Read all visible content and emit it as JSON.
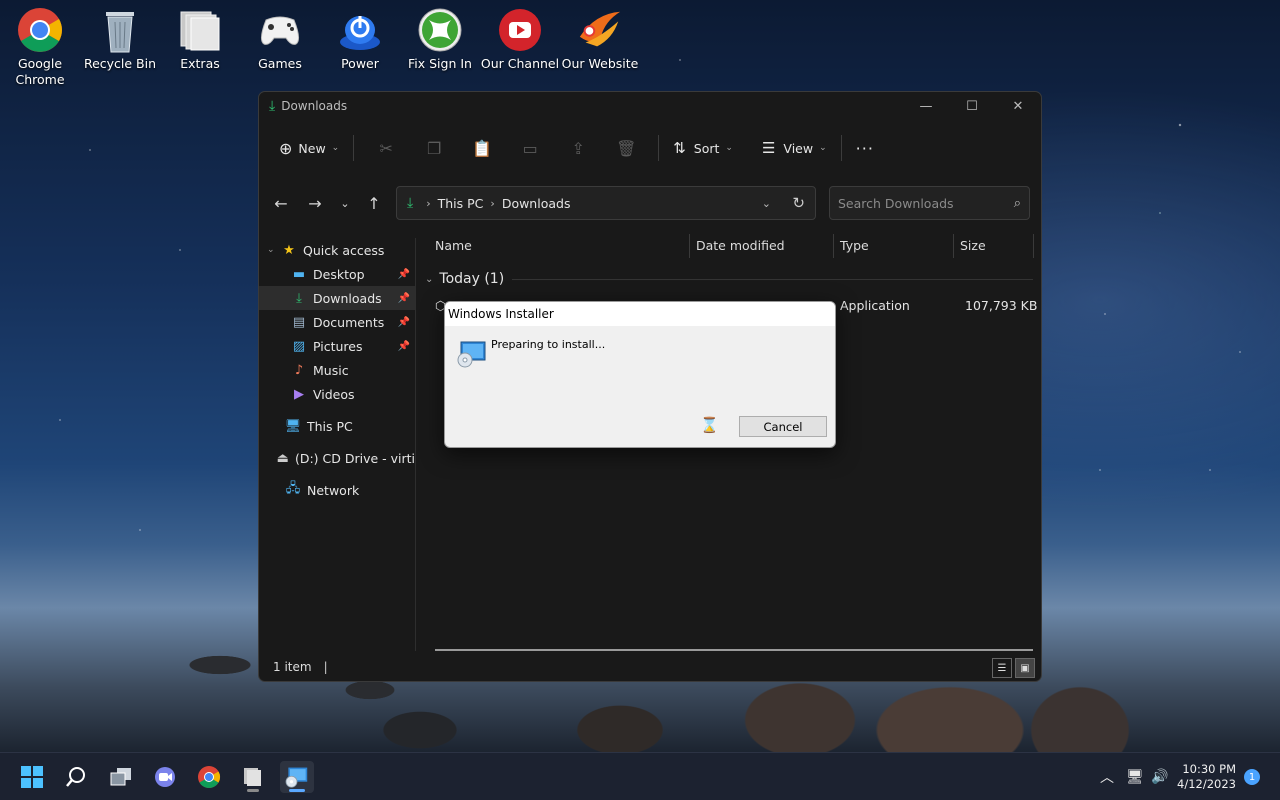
{
  "desktop_icons": [
    {
      "label": "Google Chrome",
      "icon": "chrome-icon"
    },
    {
      "label": "Recycle Bin",
      "icon": "recycle-bin-icon"
    },
    {
      "label": "Extras",
      "icon": "folder-icon"
    },
    {
      "label": "Games",
      "icon": "gamepad-icon"
    },
    {
      "label": "Power",
      "icon": "power-icon"
    },
    {
      "label": "Fix Sign In",
      "icon": "xbox-icon"
    },
    {
      "label": "Our Channel",
      "icon": "youtube-icon"
    },
    {
      "label": "Our Website",
      "icon": "website-logo-icon"
    }
  ],
  "explorer": {
    "title": "Downloads",
    "toolbar": {
      "new_label": "New",
      "sort_label": "Sort",
      "view_label": "View",
      "more_label": "···"
    },
    "breadcrumb": [
      "This PC",
      "Downloads"
    ],
    "search_placeholder": "Search Downloads",
    "sidebar": {
      "quick_access": "Quick access",
      "pinned": [
        "Desktop",
        "Downloads",
        "Documents",
        "Pictures"
      ],
      "others": [
        "Music",
        "Videos"
      ],
      "this_pc": "This PC",
      "cd_drive": "(D:) CD Drive - virti",
      "network": "Network"
    },
    "columns": [
      "Name",
      "Date modified",
      "Type",
      "Size"
    ],
    "group_label": "Today (1)",
    "file": {
      "type": "Application",
      "size": "107,793 KB"
    },
    "status": "1 item"
  },
  "installer": {
    "title": "Windows Installer",
    "message": "Preparing to install...",
    "cancel_label": "Cancel"
  },
  "taskbar": {
    "time": "10:30 PM",
    "date": "4/12/2023",
    "notifications": "1"
  },
  "colors": {
    "accent": "#4aa3ff",
    "window_bg": "#191919",
    "dialog_bg": "#f0f0f0"
  }
}
